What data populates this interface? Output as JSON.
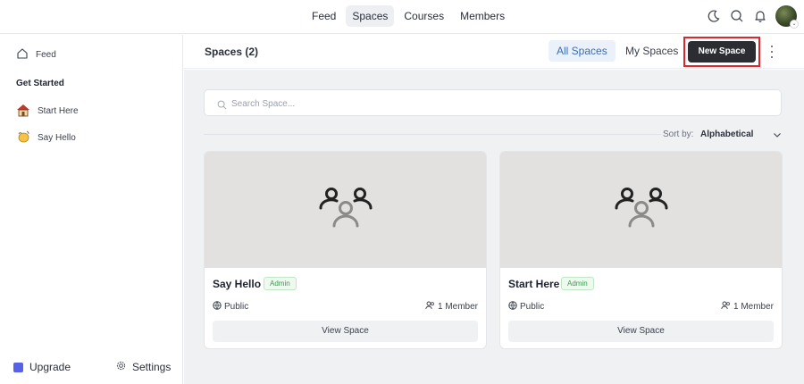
{
  "nav": {
    "items": [
      {
        "label": "Feed",
        "active": false
      },
      {
        "label": "Spaces",
        "active": true
      },
      {
        "label": "Courses",
        "active": false
      },
      {
        "label": "Members",
        "active": false
      }
    ],
    "icons": [
      "moon-icon",
      "search-icon",
      "bell-icon",
      "avatar"
    ]
  },
  "sidebar": {
    "feed_label": "Feed",
    "section_heading": "Get Started",
    "items": [
      {
        "label": "Start Here",
        "icon": "house-icon"
      },
      {
        "label": "Say Hello",
        "icon": "waving-hand-icon"
      }
    ],
    "upgrade_label": "Upgrade",
    "settings_label": "Settings"
  },
  "header": {
    "title": "Spaces (2)",
    "tabs": [
      {
        "label": "All Spaces",
        "active": true
      },
      {
        "label": "My Spaces",
        "active": false
      }
    ],
    "new_space_label": "New Space"
  },
  "search": {
    "placeholder": "Search Space...",
    "value": ""
  },
  "sort": {
    "label": "Sort by:",
    "value": "Alphabetical"
  },
  "spaces": [
    {
      "name": "Say Hello",
      "badge": "Admin",
      "privacy": "Public",
      "members": "1 Member",
      "button": "View Space"
    },
    {
      "name": "Start Here",
      "badge": "Admin",
      "privacy": "Public",
      "members": "1 Member",
      "button": "View Space"
    }
  ],
  "colors": {
    "accent": "#3b6db4",
    "primary_button": "#2b2d33",
    "highlight_outline": "#e0262d",
    "badge_green": "#3c9a4e",
    "upgrade_icon": "#5661e8"
  }
}
